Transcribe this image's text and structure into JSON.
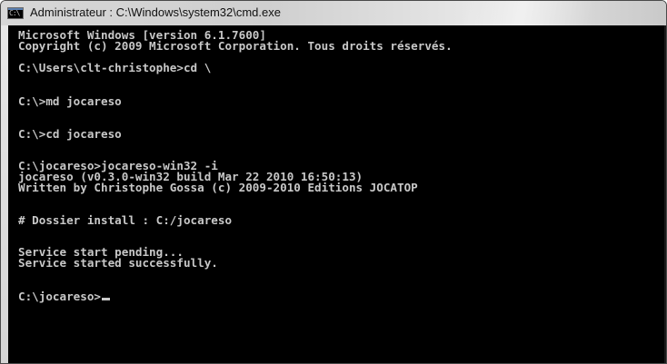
{
  "window": {
    "title": "Administrateur : C:\\Windows\\system32\\cmd.exe",
    "icon": "cmd-icon",
    "icon_text": "C:\\"
  },
  "console": {
    "lines": [
      "Microsoft Windows [version 6.1.7600]",
      "Copyright (c) 2009 Microsoft Corporation. Tous droits réservés.",
      "C:\\Users\\clt-christophe>cd \\",
      "C:\\>md jocareso",
      "C:\\>cd jocareso",
      "C:\\jocareso>jocareso-win32 -i",
      "jocareso (v0.3.0-win32 build Mar 22 2010 16:50:13)",
      "Written by Christophe Gossa (c) 2009-2010 Editions JOCATOP",
      "# Dossier install : C:/jocareso",
      "Service start pending...",
      "Service started successfully.",
      "C:\\jocareso>"
    ]
  }
}
